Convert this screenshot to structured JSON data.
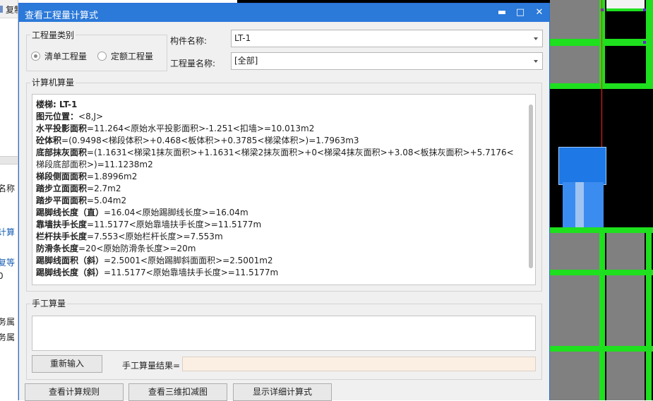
{
  "left_app": {
    "top_label": "复制",
    "fragments": [
      "名称",
      "计算",
      "复等",
      "0",
      "务属",
      "务属"
    ]
  },
  "dialog": {
    "title": "查看工程量计算式",
    "buttons": {
      "minimize": "▬",
      "maximize": "□",
      "close": "✕"
    },
    "qty_type": {
      "legend": "工程量类别",
      "options": [
        "清单工程量",
        "定额工程量"
      ],
      "selected": "清单工程量"
    },
    "component_label": "构件名称:",
    "component_value": "LT-1",
    "qty_name_label": "工程量名称:",
    "qty_name_value": "[全部]",
    "computer_calc": {
      "legend": "计算机算量",
      "lines": [
        {
          "key": "楼梯: LT-1",
          "val": ""
        },
        {
          "key": "图元位置：",
          "val": "<8,J>"
        },
        {
          "key": "水平投影面积",
          "val": "=11.264<原始水平投影面积>-1.251<扣墙>=10.013m2"
        },
        {
          "key": "砼体积",
          "val": "=(0.9498<梯段体积>+0.468<板体积>+0.3785<梯梁体积>)=1.7963m3"
        },
        {
          "key": "底部抹灰面积",
          "val": "=(1.1631<梯梁1抹灰面积>+1.1631<梯梁2抹灰面积>+0<梯梁4抹灰面积>+3.08<板抹灰面积>+5.7176<梯段底部面积>)=11.1238m2"
        },
        {
          "key": "梯段侧面面积",
          "val": "=1.8996m2"
        },
        {
          "key": "踏步立面面积",
          "val": "=2.7m2"
        },
        {
          "key": "踏步平面面积",
          "val": "=5.04m2"
        },
        {
          "key": "踢脚线长度（直）",
          "val": "=16.04<原始踢脚线长度>=16.04m"
        },
        {
          "key": "靠墙扶手长度",
          "val": "=11.5177<原始靠墙扶手长度>=11.5177m"
        },
        {
          "key": "栏杆扶手长度",
          "val": "=7.553<原始栏杆长度>=7.553m"
        },
        {
          "key": "防滑条长度",
          "val": "=20<原始防滑条长度>=20m"
        },
        {
          "key": "踢脚线面积（斜）",
          "val": "=2.5001<原始踢脚斜面面积>=2.5001m2"
        },
        {
          "key": "踢脚线长度（斜）",
          "val": "=11.5177<原始靠墙扶手长度>=11.5177m"
        }
      ]
    },
    "manual_calc": {
      "legend": "手工算量",
      "reenter_button": "重新输入",
      "result_label": "手工算量结果="
    },
    "footer_buttons": [
      "查看计算规则",
      "查看三维扣减图",
      "显示详细计算式"
    ]
  }
}
